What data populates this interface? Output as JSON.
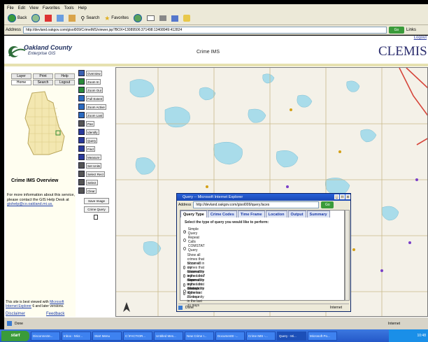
{
  "browser": {
    "menu": [
      "File",
      "Edit",
      "View",
      "Favorites",
      "Tools",
      "Help"
    ],
    "toolbar": {
      "back": "Back",
      "search": "Search",
      "favorites": "Favorites"
    },
    "address_label": "Address",
    "url": "http://devland.oakgov.com/gisol009/CrimeIMS/viewer.jsp?BOX=13089506:371498:13408949:412824",
    "go": "Go",
    "links": "Links"
  },
  "page": {
    "logout": "Logout",
    "logo_line1": "Oakland County",
    "logo_line2": "Enterprise GIS",
    "app_title": "Crime IMS",
    "partner_logo": "CLEMIS"
  },
  "left_panel": {
    "row1": [
      "Layer",
      "Print",
      "Help"
    ],
    "row2": [
      "Home",
      "Search",
      "Logout"
    ],
    "overview_title": "Crime IMS  Overview",
    "info_text": "For more information about this service, please contact the GIS Help Desk at ",
    "info_email": "gishelp@co.oakland.mi.us.",
    "bottom_note_prefix": "This site is best viewed with ",
    "bottom_note_link": "Microsoft Internet Explorer",
    "bottom_note_suffix": " 6 and later versions.",
    "disclaimer": "Disclaimer",
    "feedback": "Feedback"
  },
  "tools": {
    "items": [
      {
        "icon": "overview-icon",
        "label": "Overview"
      },
      {
        "icon": "zoom-in-icon",
        "label": "Zoom In"
      },
      {
        "icon": "zoom-out-icon",
        "label": "Zoom Out"
      },
      {
        "icon": "full-extent-icon",
        "label": "Full Extent"
      },
      {
        "icon": "zoom-active-icon",
        "label": "Zoom Active"
      },
      {
        "icon": "zoom-last-icon",
        "label": "Zoom Last"
      },
      {
        "icon": "pan-icon",
        "label": "Pan"
      },
      {
        "icon": "identify-icon",
        "label": "Identify"
      },
      {
        "icon": "query-icon",
        "label": "Query"
      },
      {
        "icon": "find-icon",
        "label": "Find"
      },
      {
        "icon": "measure-icon",
        "label": "Measure"
      },
      {
        "icon": "set-units-icon",
        "label": "Set Units"
      },
      {
        "icon": "select-rect-icon",
        "label": "Select Rect"
      },
      {
        "icon": "select-icon",
        "label": "Select"
      },
      {
        "icon": "clear-icon",
        "label": "Clear"
      }
    ],
    "save_image": "Save Image",
    "crime_query": "Crime Query"
  },
  "dialog": {
    "title": "Query -- Microsoft Internet Explorer",
    "address_label": "Address",
    "url": "http://devland.oakgov.com/gisol009/query.faces",
    "go": "Go",
    "tabs": [
      "Query Type",
      "Crime Codes",
      "Time Frame",
      "Location",
      "Output",
      "Summary"
    ],
    "prompt": "Select the type of query you would like to perform:",
    "options": [
      "Simple Query",
      "Repeat Calls",
      "COMSTAT Query",
      "Show all crimes that occurred in my community in the last 7 days",
      "Show all crimes that occurred in my community in the last 14 days",
      "Show all crimes that occurred in my community in the last 21 days",
      "Show all crimes that occurred in my community in the last 30 days",
      "Saved Queries"
    ],
    "selected_index": 0,
    "status_done": "Done",
    "status_zone": "Internet"
  },
  "status_bar": {
    "done": "Done",
    "zone": "Internet"
  },
  "taskbar": {
    "start": "start",
    "tasks": [
      "Disconnecte...",
      "Inbox - Micr...",
      "Start Menu",
      "C:\\FACTIOR...",
      "Untitled Mes...",
      "New Crime I...",
      "Document8 -...",
      "Crime IMS -...",
      "Query - Mi...",
      "Microsoft Po..."
    ],
    "active_index": 8,
    "clock": "10:48"
  }
}
